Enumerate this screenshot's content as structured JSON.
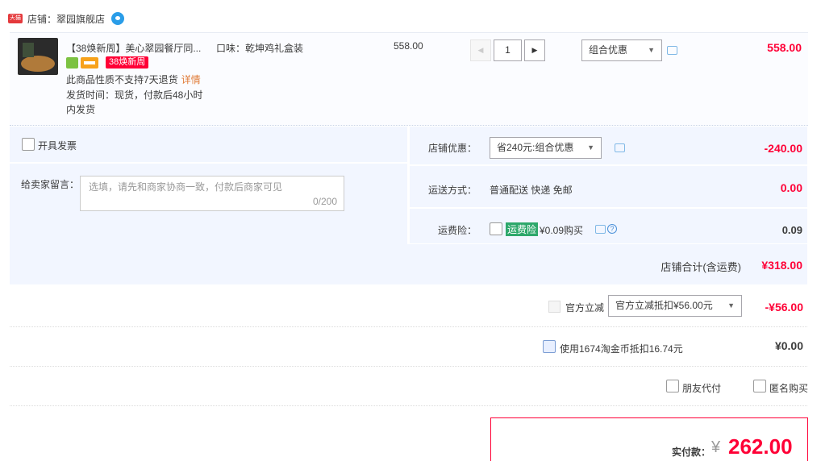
{
  "shop": {
    "badge": "天猫",
    "label": "店铺：",
    "name": "翠园旗舰店"
  },
  "item": {
    "title": "【38焕新周】美心翠园餐厅同...",
    "promo_tag": "38焕新周",
    "return_notice": "此商品性质不支持7天退货",
    "detail_link": "详情",
    "ship_line1": "发货时间：现货，付款后48小时",
    "ship_line2": "内发货",
    "flavor": "口味：乾坤鸡礼盒装",
    "unit_price": "558.00",
    "quantity": "1",
    "discount_select": "组合优惠",
    "subtotal": "558.00"
  },
  "options": {
    "invoice_label": "开具发票",
    "note_label": "给卖家留言：",
    "note_placeholder": "选填，请先和商家协商一致，付款后商家可见",
    "note_count": "0/200",
    "shop_discount_label": "店铺优惠：",
    "shop_discount_select": "省240元:组合优惠",
    "shop_discount_amount": "-240.00",
    "shipping_label": "运送方式：",
    "shipping_value": "普通配送 快递 免邮",
    "shipping_amount": "0.00",
    "insurance_label": "运费险：",
    "insurance_tag": "运费险",
    "insurance_price": "¥0.09购买",
    "insurance_amount": "0.09",
    "shop_total_label": "店铺合计(含运费)",
    "shop_total": "¥318.00"
  },
  "official": {
    "label": "官方立减",
    "select": "官方立减抵扣¥56.00元",
    "amount": "-¥56.00"
  },
  "coins": {
    "label": "使用1674淘金币抵扣16.74元",
    "amount": "¥0.00"
  },
  "extras": {
    "friend_pay": "朋友代付",
    "anonymous": "匿名购买"
  },
  "payment": {
    "label": "实付款：",
    "currency": "¥",
    "total": "262.00"
  },
  "colors": {
    "accent_red": "#ff0036",
    "panel_bg": "#f2f6ff"
  }
}
